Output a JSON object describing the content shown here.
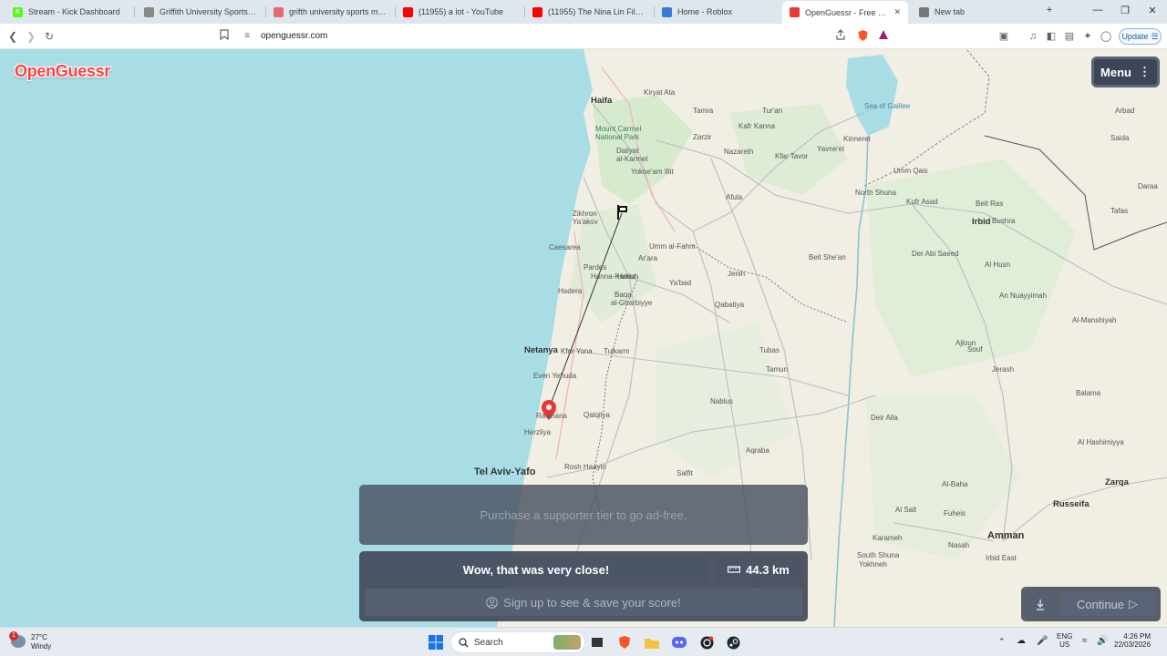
{
  "browser": {
    "tabs": [
      {
        "title": "Stream - Kick Dashboard",
        "icon": "kick-icon",
        "color": "#53fc18",
        "letter": "K"
      },
      {
        "title": "Griffith University Sports Mana",
        "icon": "globe-icon",
        "color": "#888888",
        "letter": ""
      },
      {
        "title": "grifth university sports manage",
        "icon": "ai-icon",
        "color": "#e46c6c",
        "letter": ""
      },
      {
        "title": "(11955) a lot - YouTube",
        "icon": "youtube-icon",
        "color": "#ff0000",
        "letter": ""
      },
      {
        "title": "(11955) The Nina Lin Files - Yo",
        "icon": "youtube-icon",
        "color": "#ff0000",
        "letter": ""
      },
      {
        "title": "Home - Roblox",
        "icon": "roblox-icon",
        "color": "#3a7bd5",
        "letter": ""
      },
      {
        "title": "OpenGuessr - Free Ge",
        "icon": "openguessr-icon",
        "color": "#e53935",
        "letter": ""
      },
      {
        "title": "New tab",
        "icon": "brave-shield-icon",
        "color": "#777777",
        "letter": ""
      }
    ],
    "new_tab_label": "+",
    "url": "openguessr.com",
    "update_label": "Update"
  },
  "game": {
    "logo": "OpenGuessr",
    "menu_label": "Menu",
    "ad_text": "Purchase a supporter tier to go ad-free.",
    "result_message": "Wow, that was very close!",
    "distance": "44.3 km",
    "signup_text": "Sign up to see & save your score!",
    "continue_label": "Continue"
  },
  "map": {
    "places": [
      {
        "t": "Haifa",
        "c": "mid"
      },
      {
        "t": "Kiryat Ata",
        "c": ""
      },
      {
        "t": "Tamra",
        "c": ""
      },
      {
        "t": "Mount Carmel",
        "c": "park"
      },
      {
        "t": "National Park",
        "c": "park"
      },
      {
        "t": "Daliyat",
        "c": ""
      },
      {
        "t": "al-Karmel",
        "c": ""
      },
      {
        "t": "Yokne'am Illit",
        "c": ""
      },
      {
        "t": "Zikhron",
        "c": ""
      },
      {
        "t": "Ya'akov",
        "c": ""
      },
      {
        "t": "Caesarea",
        "c": ""
      },
      {
        "t": "Pardes",
        "c": ""
      },
      {
        "t": "Hanna-Karkur",
        "c": ""
      },
      {
        "t": "Hadera",
        "c": ""
      },
      {
        "t": "Harish",
        "c": ""
      },
      {
        "t": "Baqa",
        "c": ""
      },
      {
        "t": "al-Gharbiyye",
        "c": ""
      },
      {
        "t": "Umm al-Fahm",
        "c": ""
      },
      {
        "t": "Ar'ara",
        "c": ""
      },
      {
        "t": "Netanya",
        "c": "mid"
      },
      {
        "t": "Kfar Yona",
        "c": ""
      },
      {
        "t": "Tulkarm",
        "c": ""
      },
      {
        "t": "Even Yehuda",
        "c": ""
      },
      {
        "t": "Ra'anana",
        "c": ""
      },
      {
        "t": "Qalqilya",
        "c": ""
      },
      {
        "t": "Herzliya",
        "c": ""
      },
      {
        "t": "Tel Aviv-Yafo",
        "c": "big"
      },
      {
        "t": "Rosh Haayin",
        "c": ""
      },
      {
        "t": "Salfit",
        "c": ""
      },
      {
        "t": "Nazareth",
        "c": ""
      },
      {
        "t": "Kafr Kanna",
        "c": ""
      },
      {
        "t": "Tur'an",
        "c": ""
      },
      {
        "t": "Zarzir",
        "c": ""
      },
      {
        "t": "Kfar Tavor",
        "c": ""
      },
      {
        "t": "Afula",
        "c": ""
      },
      {
        "t": "Yavne'el",
        "c": ""
      },
      {
        "t": "Kinneret",
        "c": ""
      },
      {
        "t": "Jenin",
        "c": ""
      },
      {
        "t": "Ya'bad",
        "c": ""
      },
      {
        "t": "Qabatiya",
        "c": ""
      },
      {
        "t": "Beit She'an",
        "c": ""
      },
      {
        "t": "Tubas",
        "c": ""
      },
      {
        "t": "Tamun",
        "c": ""
      },
      {
        "t": "Nablus",
        "c": ""
      },
      {
        "t": "Aqraba",
        "c": ""
      },
      {
        "t": "Sea of Galilee",
        "c": "sea"
      },
      {
        "t": "Umm Qais",
        "c": ""
      },
      {
        "t": "North Shuna",
        "c": ""
      },
      {
        "t": "Kufr Asad",
        "c": ""
      },
      {
        "t": "Irbid",
        "c": "mid"
      },
      {
        "t": "Beit Ras",
        "c": ""
      },
      {
        "t": "Bushra",
        "c": ""
      },
      {
        "t": "Der Abi Saeed",
        "c": ""
      },
      {
        "t": "Al Husn",
        "c": ""
      },
      {
        "t": "An Nuayyimah",
        "c": ""
      },
      {
        "t": "Ajloun",
        "c": ""
      },
      {
        "t": "Souf",
        "c": ""
      },
      {
        "t": "Jerash",
        "c": ""
      },
      {
        "t": "Al-Manshiyah",
        "c": ""
      },
      {
        "t": "Deir Alla",
        "c": ""
      },
      {
        "t": "Balama",
        "c": ""
      },
      {
        "t": "Al Hashimiyya",
        "c": ""
      },
      {
        "t": "Zarqa",
        "c": "mid"
      },
      {
        "t": "Russeifa",
        "c": "mid"
      },
      {
        "t": "Al-Baha",
        "c": ""
      },
      {
        "t": "Al Salt",
        "c": ""
      },
      {
        "t": "Fuheis",
        "c": ""
      },
      {
        "t": "Amman",
        "c": "big"
      },
      {
        "t": "Karameh",
        "c": ""
      },
      {
        "t": "South Shuna",
        "c": ""
      },
      {
        "t": "Yokhneh",
        "c": ""
      },
      {
        "t": "Nasah",
        "c": ""
      },
      {
        "t": "Irbid East",
        "c": ""
      },
      {
        "t": "Arbad",
        "c": ""
      },
      {
        "t": "Saida",
        "c": ""
      },
      {
        "t": "Daraa",
        "c": ""
      },
      {
        "t": "Tafas",
        "c": ""
      }
    ]
  },
  "taskbar": {
    "weather_temp": "27°C",
    "weather_desc": "Windy",
    "weather_badge": "1",
    "search_placeholder": "Search",
    "lang": "ENG",
    "region": "US",
    "time": "4:26 PM",
    "date": "22/03/2026"
  }
}
